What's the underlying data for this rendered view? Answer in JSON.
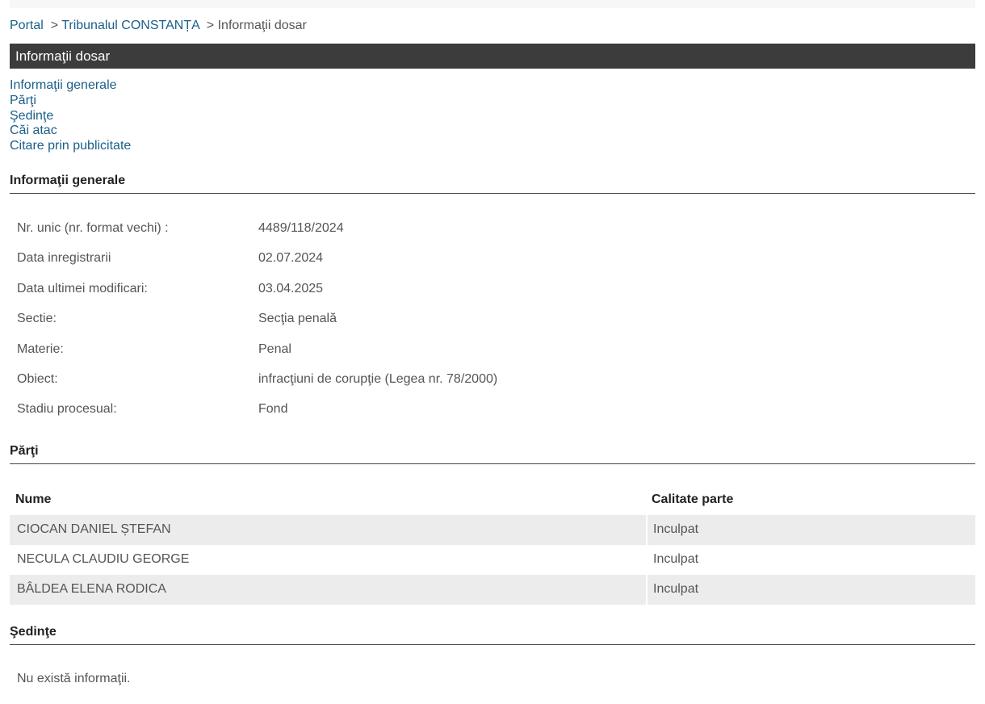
{
  "breadcrumb": {
    "portal": "Portal",
    "sep1": ">",
    "court": "Tribunalul CONSTANȚA",
    "sep2": ">",
    "current": "Informaţii dosar"
  },
  "page_title": "Informaţii dosar",
  "anchors": [
    "Informaţii generale",
    "Părţi",
    "Şedinţe",
    "Căi atac",
    "Citare prin publicitate"
  ],
  "general": {
    "heading": "Informaţii generale",
    "rows": [
      {
        "label": "Nr. unic (nr. format vechi) :",
        "value": "4489/118/2024"
      },
      {
        "label": "Data inregistrarii",
        "value": "02.07.2024"
      },
      {
        "label": "Data ultimei modificari:",
        "value": "03.04.2025"
      },
      {
        "label": "Sectie:",
        "value": "Secţia penală"
      },
      {
        "label": "Materie:",
        "value": "Penal"
      },
      {
        "label": "Obiect:",
        "value": "infracţiuni de corupţie (Legea nr. 78/2000)"
      },
      {
        "label": "Stadiu procesual:",
        "value": "Fond"
      }
    ]
  },
  "parti": {
    "heading": "Părţi",
    "columns": [
      "Nume",
      "Calitate parte"
    ],
    "rows": [
      {
        "nume": "CIOCAN DANIEL ȘTEFAN",
        "calitate": "Inculpat"
      },
      {
        "nume": "NECULA CLAUDIU GEORGE",
        "calitate": "Inculpat"
      },
      {
        "nume": "BÂLDEA ELENA RODICA",
        "calitate": "Inculpat"
      }
    ]
  },
  "sedinte": {
    "heading": "Şedinţe",
    "empty_text": "Nu există informaţii."
  },
  "colors": {
    "link": "#1a5f8a",
    "title_bar": "#3c3c3c",
    "row_stripe": "#ececec"
  }
}
